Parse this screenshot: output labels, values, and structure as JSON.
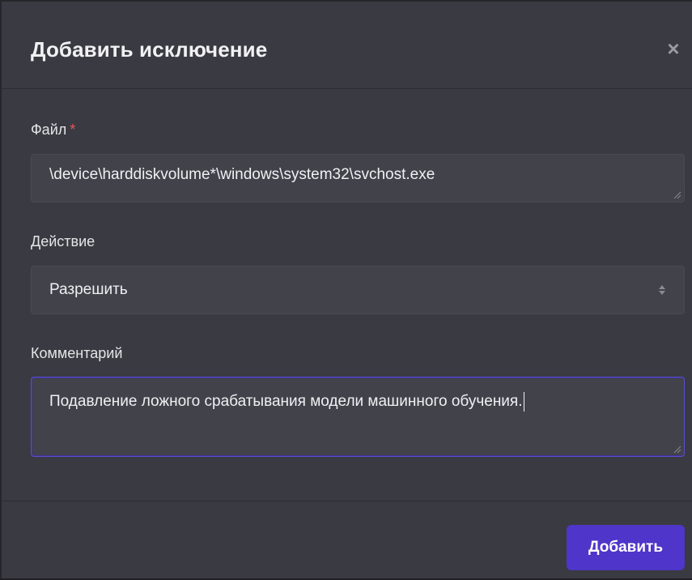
{
  "dialog": {
    "title": "Добавить исключение",
    "close_glyph": "×"
  },
  "form": {
    "file": {
      "label": "Файл",
      "required_mark": "*",
      "value": "\\device\\harddiskvolume*\\windows\\system32\\svchost.exe"
    },
    "action": {
      "label": "Действие",
      "selected": "Разрешить"
    },
    "comment": {
      "label": "Комментарий",
      "value": "Подавление ложного срабатывания модели машинного обучения."
    }
  },
  "footer": {
    "submit_label": "Добавить"
  },
  "colors": {
    "accent": "#4f35c9",
    "required": "#e05a5a",
    "focus_border": "#5a4fd0"
  }
}
